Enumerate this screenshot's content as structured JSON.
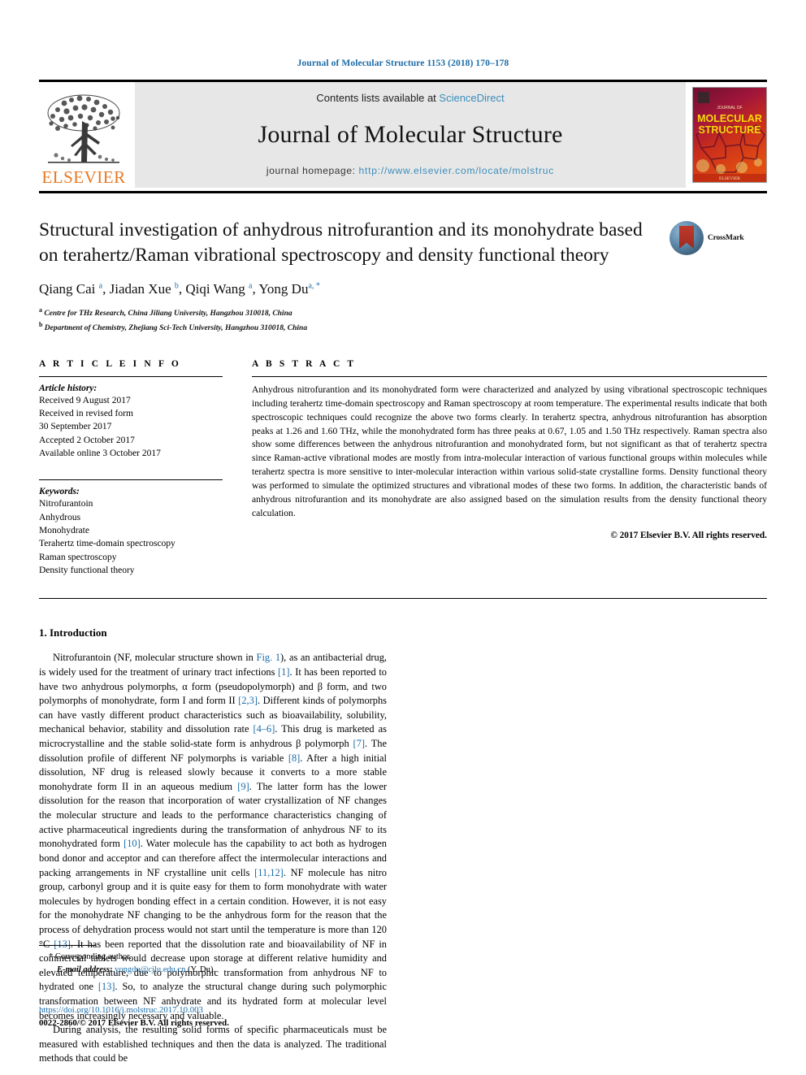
{
  "running_head": "Journal of Molecular Structure 1153 (2018) 170–178",
  "masthead": {
    "contents_prefix": "Contents lists available at ",
    "sciencedirect": "ScienceDirect",
    "journal_name": "Journal of Molecular Structure",
    "homepage_label": "journal homepage:",
    "homepage_url": "http://www.elsevier.com/locate/molstruc",
    "publisher": "ELSEVIER",
    "cover_line1": "MOLECULAR",
    "cover_line2": "STRUCTURE"
  },
  "crossmark": {
    "label": "CrossMark"
  },
  "title": "Structural investigation of anhydrous nitrofurantion and its monohydrate based on terahertz/Raman vibrational spectroscopy and density functional theory",
  "authors": [
    {
      "name": "Qiang Cai",
      "sup": "a"
    },
    {
      "name": "Jiadan Xue",
      "sup": "b"
    },
    {
      "name": "Qiqi Wang",
      "sup": "a"
    },
    {
      "name": "Yong Du",
      "sup": "a, *"
    }
  ],
  "affiliations": [
    {
      "sup": "a",
      "text": "Centre for THz Research, China Jiliang University, Hangzhou 310018, China"
    },
    {
      "sup": "b",
      "text": "Department of Chemistry, Zhejiang Sci-Tech University, Hangzhou 310018, China"
    }
  ],
  "article_info": {
    "heading": "A R T I C L E   I N F O",
    "history_title": "Article history:",
    "history": [
      "Received 9 August 2017",
      "Received in revised form",
      "30 September 2017",
      "Accepted 2 October 2017",
      "Available online 3 October 2017"
    ],
    "keywords_title": "Keywords:",
    "keywords": [
      "Nitrofurantoin",
      "Anhydrous",
      "Monohydrate",
      "Terahertz time-domain spectroscopy",
      "Raman spectroscopy",
      "Density functional theory"
    ]
  },
  "abstract": {
    "heading": "A B S T R A C T",
    "text": "Anhydrous nitrofurantion and its monohydrated form were characterized and analyzed by using vibrational spectroscopic techniques including terahertz time-domain spectroscopy and Raman spectroscopy at room temperature. The experimental results indicate that both spectroscopic techniques could recognize the above two forms clearly. In terahertz spectra, anhydrous nitrofurantion has absorption peaks at 1.26 and 1.60 THz, while the monohydrated form has three peaks at 0.67, 1.05 and 1.50 THz respectively. Raman spectra also show some differences between the anhydrous nitrofurantion and monohydrated form, but not significant as that of terahertz spectra since Raman-active vibrational modes are mostly from intra-molecular interaction of various functional groups within molecules while terahertz spectra is more sensitive to inter-molecular interaction within various solid-state crystalline forms. Density functional theory was performed to simulate the optimized structures and vibrational modes of these two forms. In addition, the characteristic bands of anhydrous nitrofurantion and its monohydrate are also assigned based on the simulation results from the density functional theory calculation.",
    "copyright": "© 2017 Elsevier B.V. All rights reserved."
  },
  "introduction": {
    "heading": "1. Introduction",
    "para1_a": "Nitrofurantoin (NF, molecular structure shown in ",
    "para1_figref": "Fig. 1",
    "para1_b": "), as an antibacterial drug, is widely used for the treatment of urinary tract infections ",
    "ref1": "[1]",
    "para1_c": ". It has been reported to have two anhydrous polymorphs, α form (pseudopolymorph) and β form, and two polymorphs of monohydrate, form I and form II ",
    "ref23": "[2,3]",
    "para1_d": ". Different kinds of polymorphs can have vastly different product characteristics such as bioavailability, solubility, mechanical behavior, stability and dissolution rate ",
    "ref46": "[4–6]",
    "para1_e": ". This drug is marketed as microcrystalline and the stable solid-state form is anhydrous β polymorph ",
    "ref7": "[7]",
    "para1_f": ". The dissolution profile of different NF polymorphs is variable ",
    "ref8": "[8]",
    "para1_g": ". After a high initial dissolution, NF drug is released slowly because it converts to a more stable monohydrate form II in an aqueous medium ",
    "ref9": "[9]",
    "para1_h": ". The latter form has the lower dissolution for the reason that incorporation of water crystallization of NF changes the molecular structure and leads to the performance characteristics changing of active pharmaceutical ingredients during the transformation of anhydrous NF to its monohydrated form ",
    "ref10": "[10]",
    "para1_i": ". Water molecule has the capability to act both as hydrogen bond donor and acceptor and can therefore affect the intermolecular interactions and packing arrangements in NF crystalline unit cells ",
    "ref1112": "[11,12]",
    "para1_j": ". NF molecule has nitro group, carbonyl group and it is quite easy for them to form monohydrate with water molecules by hydrogen bonding effect in a certain condition. However, it is not easy for the monohydrate NF changing to be the anhydrous form for the reason that the process of dehydration process would not start until the temperature is more than 120 °C ",
    "ref13a": "[13]",
    "para1_k": ". It has been reported that the dissolution rate and bioavailability of NF in commercial tablets would decrease upon storage at different relative humidity and elevated temperature, due to polymorphic transformation from anhydrous NF to hydrated one ",
    "ref13b": "[13]",
    "para1_l": ". So, to analyze the structural change during such polymorphic transformation between NF anhydrate and its hydrated form at molecular level becomes increasingly necessary and valuable.",
    "para2": "During analysis, the resulting solid forms of specific pharmaceuticals must be measured with established techniques and then the data is analyzed. The traditional methods that could be"
  },
  "footnote": {
    "star": "*",
    "corresponding": "Corresponding author.",
    "email_label": "E-mail address:",
    "email": "yongdu@cjlu.edu.cn",
    "email_suffix": "(Y. Du)."
  },
  "bottom": {
    "doi": "https://doi.org/10.1016/j.molstruc.2017.10.003",
    "issn_line": "0022-2860/© 2017 Elsevier B.V. All rights reserved."
  },
  "colors": {
    "link_blue": "#1b6ca8",
    "sciencedirect_blue": "#3c8dbc",
    "elsevier_orange": "#e87722",
    "band_gray": "#e7e7e7"
  }
}
